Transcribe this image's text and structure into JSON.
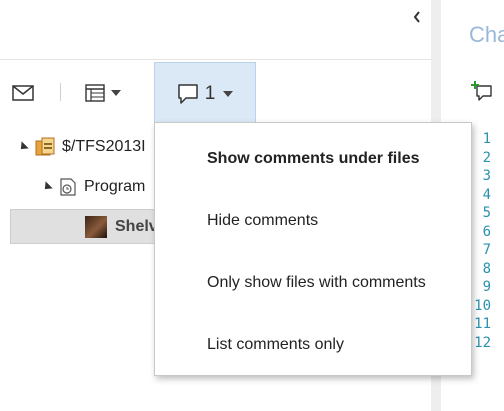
{
  "toolbar": {
    "comment_count": "1",
    "icons": [
      "mail-icon",
      "table-view-icon",
      "comment-icon",
      "chevron-left-icon"
    ]
  },
  "tree": {
    "root_label": "$/TFS2013I",
    "folder_label": "Program",
    "shelveset_label": "Shelv"
  },
  "menu": {
    "items": [
      "Show comments under files",
      "Hide comments",
      "Only show files with comments",
      "List comments only"
    ]
  },
  "right_pane": {
    "title": "Cha",
    "line_numbers": [
      "1",
      "2",
      "3",
      "4",
      "5",
      "6",
      "7",
      "8",
      "9",
      "10",
      "11",
      "12"
    ]
  },
  "colors": {
    "accent_selected": "#dbe9f7",
    "line_number": "#2b91af",
    "title_faded": "#9ab8d9"
  }
}
